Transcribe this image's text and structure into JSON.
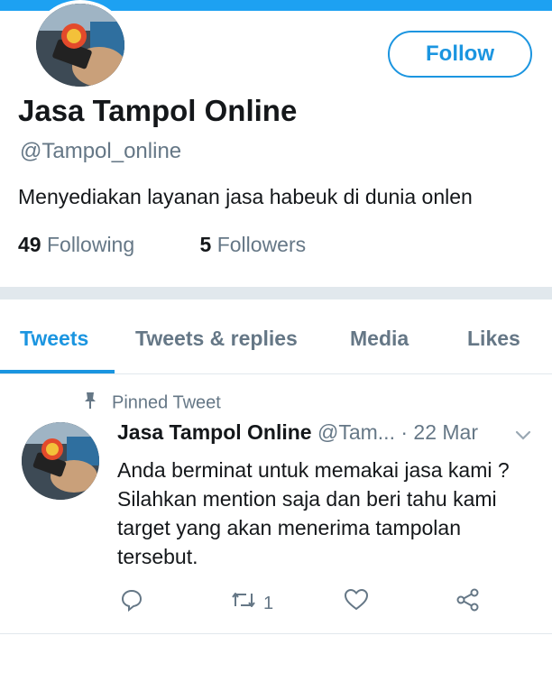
{
  "profile": {
    "display_name": "Jasa Tampol Online",
    "handle": "@Tampol_online",
    "bio": "Menyediakan layanan jasa habeuk di dunia onlen",
    "following_count": "49",
    "following_label": "Following",
    "followers_count": "5",
    "followers_label": "Followers",
    "follow_button_label": "Follow"
  },
  "tabs": [
    {
      "label": "Tweets",
      "active": true
    },
    {
      "label": "Tweets & replies",
      "active": false
    },
    {
      "label": "Media",
      "active": false
    },
    {
      "label": "Likes",
      "active": false
    }
  ],
  "tweet": {
    "pinned_label": "Pinned Tweet",
    "author_name": "Jasa Tampol Online",
    "author_handle": "@Tam...",
    "separator": "·",
    "date": "22 Mar",
    "text": "Anda berminat untuk memakai jasa kami ? Silahkan mention saja dan beri tahu kami target yang akan menerima tampolan tersebut.",
    "retweet_count": "1",
    "icons": [
      "pin-icon",
      "chevron-down-icon",
      "reply-icon",
      "retweet-icon",
      "like-icon",
      "share-icon"
    ]
  },
  "colors": {
    "accent": "#1b95e0",
    "topbar": "#1da1f2",
    "secondary_text": "#657786",
    "divider": "#e1e8ed"
  }
}
